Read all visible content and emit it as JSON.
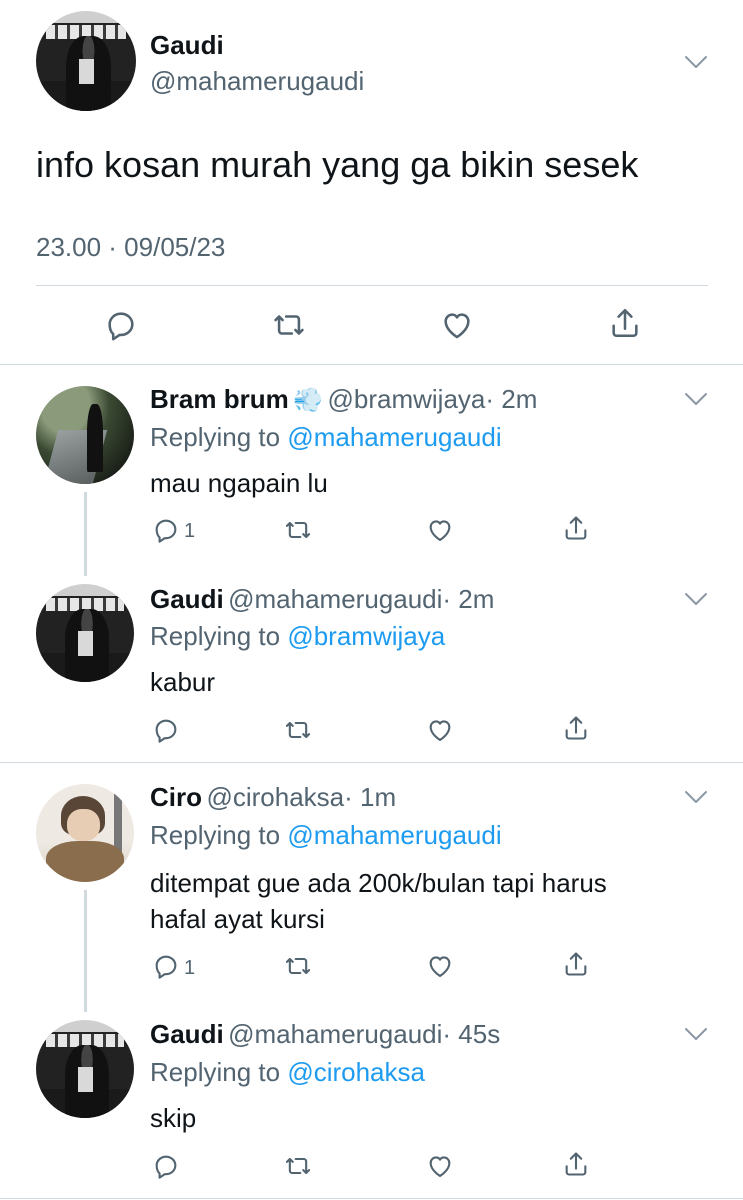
{
  "main_tweet": {
    "name": "Gaudi",
    "handle": "@mahamerugaudi",
    "text": "info kosan murah yang ga bikin sesek",
    "timestamp": "23.00 · 09/05/23"
  },
  "replies": [
    {
      "name": "Bram brum",
      "emoji": "💨",
      "handle": "@bramwijaya",
      "time": "· 2m",
      "replying_prefix": "Replying to ",
      "replying_to": "@mahamerugaudi",
      "text": "mau ngapain lu",
      "reply_count": "1"
    },
    {
      "name": "Gaudi",
      "handle": "@mahamerugaudi",
      "time": "· 2m",
      "replying_prefix": "Replying to ",
      "replying_to": "@bramwijaya",
      "text": "kabur",
      "reply_count": ""
    },
    {
      "name": "Ciro",
      "handle": "@cirohaksa",
      "time": "· 1m",
      "replying_prefix": "Replying to ",
      "replying_to": "@mahamerugaudi",
      "text_line1": "ditempat gue ada 200k/bulan tapi harus",
      "text_line2": "hafal ayat kursi",
      "reply_count": "1"
    },
    {
      "name": "Gaudi",
      "handle": "@mahamerugaudi",
      "time": "· 45s",
      "replying_prefix": "Replying to ",
      "replying_to": "@cirohaksa",
      "text": "skip",
      "reply_count": ""
    }
  ],
  "icons": {
    "reply": "reply-icon",
    "retweet": "retweet-icon",
    "like": "heart-icon",
    "share": "share-icon",
    "more": "chevron-down-icon"
  },
  "colors": {
    "text": "#0f1419",
    "secondary": "#536471",
    "link": "#1d9bf0",
    "divider": "#cfd9de"
  }
}
